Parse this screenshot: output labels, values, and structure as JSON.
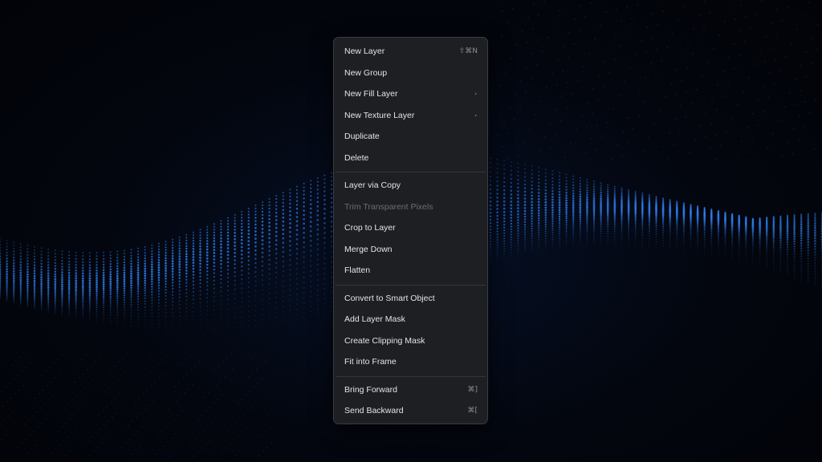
{
  "theme": {
    "menu_bg": "#1e1f22",
    "menu_border": "#3a3c40",
    "text": "#e3e4e6",
    "disabled_text": "#6c6e73",
    "shortcut_text": "#8b8d92",
    "wave_accent": "#2f7ff0"
  },
  "menu": {
    "groups": [
      [
        {
          "label": "New Layer",
          "shortcut": "⇧⌘N",
          "submenu": false,
          "disabled": false
        },
        {
          "label": "New Group",
          "shortcut": "",
          "submenu": false,
          "disabled": false
        },
        {
          "label": "New Fill Layer",
          "shortcut": "",
          "submenu": true,
          "disabled": false
        },
        {
          "label": "New Texture Layer",
          "shortcut": "",
          "submenu": true,
          "disabled": false
        },
        {
          "label": "Duplicate",
          "shortcut": "",
          "submenu": false,
          "disabled": false
        },
        {
          "label": "Delete",
          "shortcut": "",
          "submenu": false,
          "disabled": false
        }
      ],
      [
        {
          "label": "Layer via Copy",
          "shortcut": "",
          "submenu": false,
          "disabled": false
        },
        {
          "label": "Trim Transparent Pixels",
          "shortcut": "",
          "submenu": false,
          "disabled": true
        },
        {
          "label": "Crop to Layer",
          "shortcut": "",
          "submenu": false,
          "disabled": false
        },
        {
          "label": "Merge Down",
          "shortcut": "",
          "submenu": false,
          "disabled": false
        },
        {
          "label": "Flatten",
          "shortcut": "",
          "submenu": false,
          "disabled": false
        }
      ],
      [
        {
          "label": "Convert to Smart Object",
          "shortcut": "",
          "submenu": false,
          "disabled": false
        },
        {
          "label": "Add Layer Mask",
          "shortcut": "",
          "submenu": false,
          "disabled": false
        },
        {
          "label": "Create Clipping Mask",
          "shortcut": "",
          "submenu": false,
          "disabled": false
        },
        {
          "label": "Fit into Frame",
          "shortcut": "",
          "submenu": false,
          "disabled": false
        }
      ],
      [
        {
          "label": "Bring Forward",
          "shortcut": "⌘]",
          "submenu": false,
          "disabled": false
        },
        {
          "label": "Send Backward",
          "shortcut": "⌘[",
          "submenu": false,
          "disabled": false
        }
      ]
    ]
  }
}
